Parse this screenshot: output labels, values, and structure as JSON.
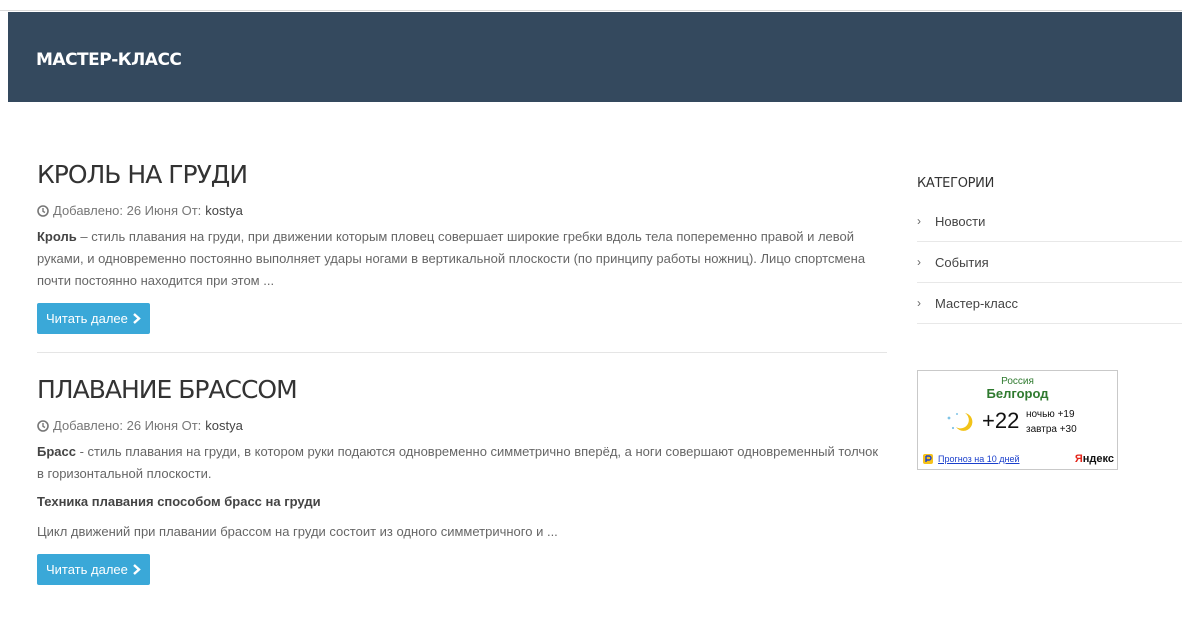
{
  "header": {
    "title": "МАСТЕР-КЛАСС"
  },
  "posts": [
    {
      "title": "КРОЛЬ НА ГРУДИ",
      "meta_prefix": "Добавлено: 26 Июня От:",
      "author": "kostya",
      "lead": "Кроль",
      "excerpt": " – стиль плавания на груди, при движении которым пловец совершает широкие гребки вдоль тела попеременно правой и левой руками, и одновременно постоянно выполняет удары ногами в вертикальной плоскости (по принципу работы ножниц). Лицо спортсмена почти постоянно находится при этом ...",
      "read_more": "Читать далее"
    },
    {
      "title": "ПЛАВАНИЕ БРАССОМ",
      "meta_prefix": "Добавлено: 26 Июня От:",
      "author": "kostya",
      "lead": "Брасс",
      "excerpt": " - стиль плавания на груди, в котором руки подаются одновременно симметрично вперёд, а ноги совершают одновременный толчок в горизонтальной плоскости.",
      "subheading": "Техника плавания способом брасс на груди",
      "excerpt2": "Цикл движений при плавании брассом на груди состоит из одного симметричного и ...",
      "read_more": "Читать далее"
    }
  ],
  "sidebar": {
    "title": "КАТЕГОРИИ",
    "categories": [
      "Новости",
      "События",
      "Мастер-класс"
    ]
  },
  "weather": {
    "country": "Россия",
    "city": "Белгород",
    "temp": "+22",
    "night": "ночью +19",
    "tomorrow": "завтра +30",
    "forecast_link": "Прогноз на 10 дней",
    "brand_first": "Я",
    "brand_rest": "ндекс"
  },
  "colors": {
    "banner": "#34495e",
    "button": "#3aa8d8",
    "weather_green": "#2f7a2f",
    "link_blue": "#1a3fcc"
  },
  "icons": {
    "meta": "clock-icon",
    "button": "chevron-right-icon",
    "category": "angle-right-icon",
    "weather": "moon-stars-icon"
  }
}
